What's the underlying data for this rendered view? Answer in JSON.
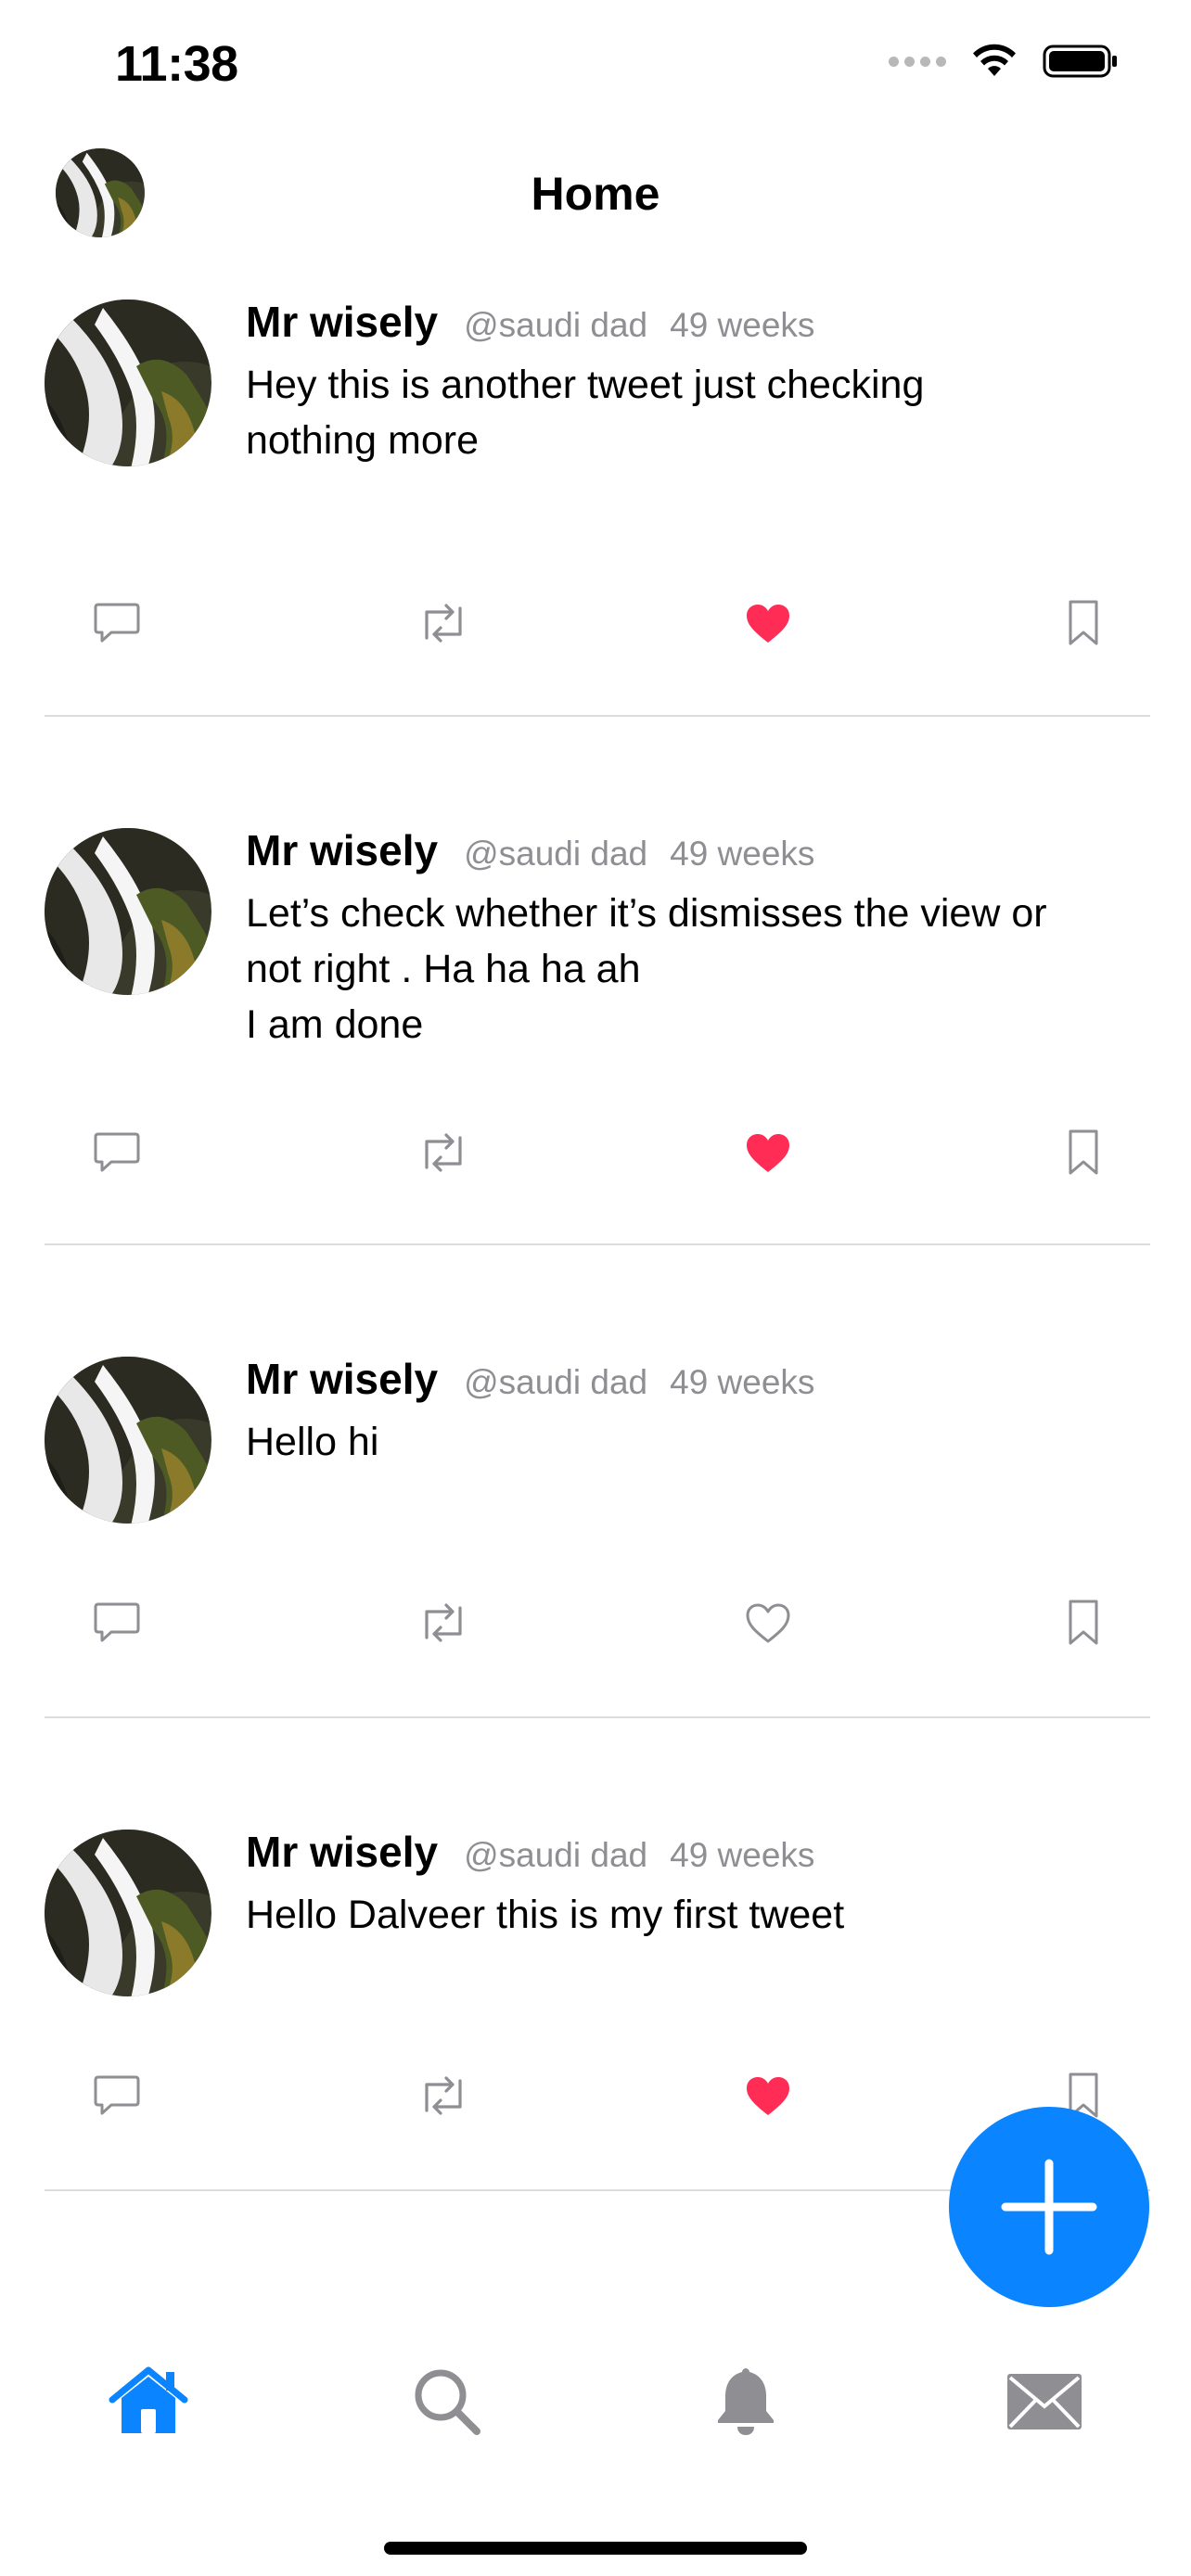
{
  "status_bar": {
    "time": "11:38"
  },
  "nav": {
    "title": "Home"
  },
  "colors": {
    "accent": "#0a84ff",
    "like_active": "#ff2d55",
    "icon_gray": "#8e8e93",
    "divider": "#dcdcdc"
  },
  "tweets": [
    {
      "name": "Mr wisely",
      "handle": "@saudi dad",
      "time": "49 weeks",
      "text": "Hey this is another tweet just checking\nnothing more",
      "liked": true
    },
    {
      "name": "Mr wisely",
      "handle": "@saudi dad",
      "time": "49 weeks",
      "text": "Let’s check whether it’s dismisses the view or\nnot right . Ha ha ha ah\nI am done",
      "liked": true
    },
    {
      "name": "Mr wisely",
      "handle": "@saudi dad",
      "time": "49 weeks",
      "text": "Hello hi",
      "liked": false
    },
    {
      "name": "Mr wisely",
      "handle": "@saudi dad",
      "time": "49 weeks",
      "text": "Hello Dalveer this is my first tweet",
      "liked": true
    }
  ],
  "icons": {
    "reply": "reply-icon",
    "retweet": "retweet-icon",
    "like": "heart-icon",
    "bookmark": "bookmark-icon",
    "compose": "plus-icon",
    "tab_home": "house-icon",
    "tab_search": "magnifier-icon",
    "tab_notifications": "bell-icon",
    "tab_messages": "envelope-icon"
  },
  "tabbar": {
    "selected": "home"
  }
}
